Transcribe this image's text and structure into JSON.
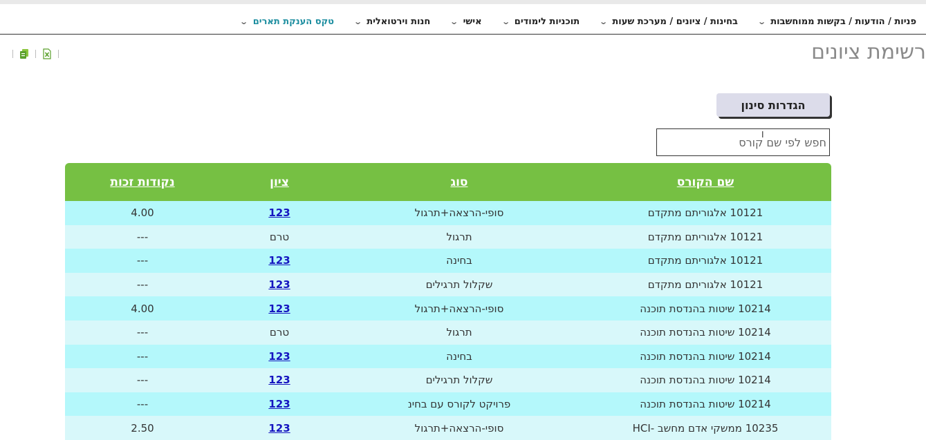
{
  "nav": {
    "items": [
      {
        "label": "פניות / הודעות / בקשות ממוחשבות"
      },
      {
        "label": "בחינות / ציונים / מערכת שעות"
      },
      {
        "label": "תוכניות לימודים"
      },
      {
        "label": "אישי"
      },
      {
        "label": "חנות וירטואלית"
      },
      {
        "label": "טקס הענקת תארים"
      }
    ]
  },
  "page": {
    "title": "רשימת ציונים"
  },
  "toolbar": {
    "icons": [
      "copy-icon",
      "excel-icon"
    ]
  },
  "filter": {
    "button_label": "הגדרות סינון",
    "search_placeholder": "חפש לפי שם קורס",
    "search_value": ""
  },
  "table": {
    "headers": [
      "שם הקורס",
      "סוג",
      "ציון",
      "נקודות זכות"
    ],
    "rows": [
      {
        "course": "10121 אלגוריתם מתקדם",
        "type": "סופי-הרצאה+תרגול",
        "grade": "123",
        "grade_link": true,
        "credits": "4.00"
      },
      {
        "course": "10121 אלגוריתם מתקדם",
        "type": "תרגול",
        "grade": "טרם",
        "grade_link": false,
        "credits": "---"
      },
      {
        "course": "10121 אלגוריתם מתקדם",
        "type": "בחינה",
        "grade": "123",
        "grade_link": true,
        "credits": "---"
      },
      {
        "course": "10121 אלגוריתם מתקדם",
        "type": "שקלול תרגילים",
        "grade": "123",
        "grade_link": true,
        "credits": "---"
      },
      {
        "course": "10214 שיטות בהנדסת תוכנה",
        "type": "סופי-הרצאה+תרגול",
        "grade": "123",
        "grade_link": true,
        "credits": "4.00"
      },
      {
        "course": "10214 שיטות בהנדסת תוכנה",
        "type": "תרגול",
        "grade": "טרם",
        "grade_link": false,
        "credits": "---"
      },
      {
        "course": "10214 שיטות בהנדסת תוכנה",
        "type": "בחינה",
        "grade": "123",
        "grade_link": true,
        "credits": "---"
      },
      {
        "course": "10214 שיטות בהנדסת תוכנה",
        "type": "שקלול תרגילים",
        "grade": "123",
        "grade_link": true,
        "credits": "---"
      },
      {
        "course": "10214 שיטות בהנדסת תוכנה",
        "type": "פרויקט לקורס עם בחינ",
        "grade": "123",
        "grade_link": true,
        "credits": "---"
      },
      {
        "course": "10235 ממשקי אדם מחשב -HCI",
        "type": "סופי-הרצאה+תרגול",
        "grade": "123",
        "grade_link": true,
        "credits": "2.50"
      }
    ]
  }
}
